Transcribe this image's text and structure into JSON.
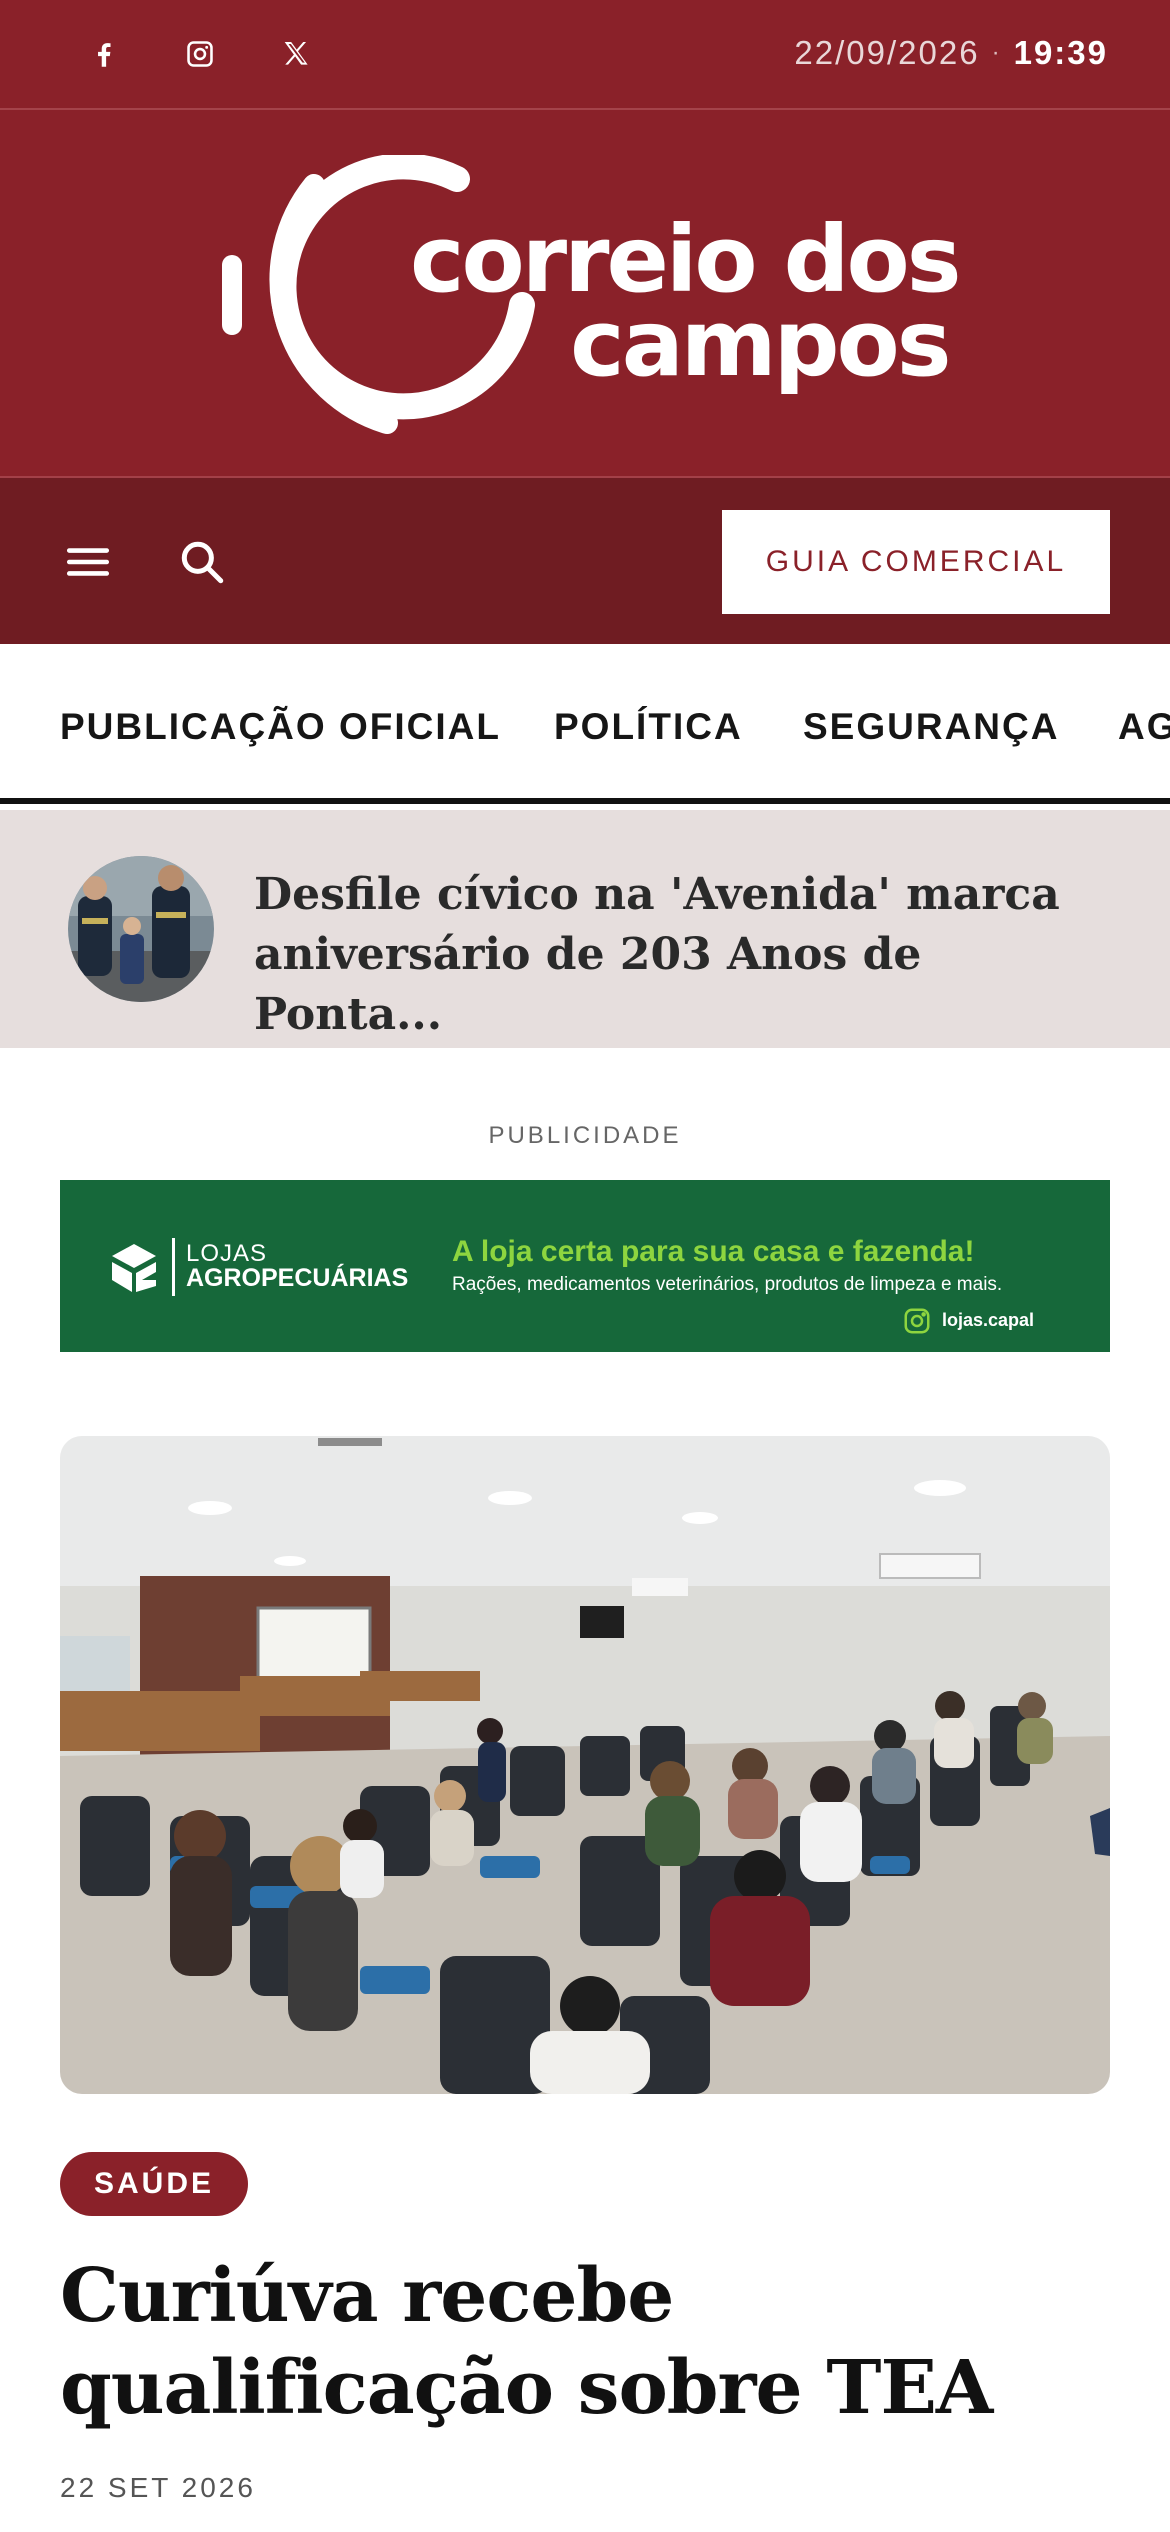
{
  "topbar": {
    "social": [
      {
        "name": "facebook-icon"
      },
      {
        "name": "instagram-icon"
      },
      {
        "name": "x-icon"
      }
    ],
    "date": "22/09/2026",
    "separator": "·",
    "time": "19:39",
    "background": "#8a2129"
  },
  "brand": {
    "line1": "correio dos",
    "line2": "campos",
    "color": "#ffffff"
  },
  "nav": {
    "menu_icon": "hamburger-menu-icon",
    "search_icon": "search-icon",
    "guia_label": "GUIA COMERCIAL",
    "background": "#6f1c22"
  },
  "categories": [
    {
      "label": "PUBLICAÇÃO OFICIAL"
    },
    {
      "label": "POLÍTICA"
    },
    {
      "label": "SEGURANÇA"
    },
    {
      "label": "AG"
    }
  ],
  "highlight": {
    "title": "Desfile cívico na 'Avenida' marca aniversário de 203 Anos de Ponta...",
    "background": "#e6dedd"
  },
  "ad": {
    "label": "PUBLICIDADE",
    "brand_line1": "LOJAS",
    "brand_line2": "AGROPECUÁRIAS",
    "headline": "A loja certa para sua casa e fazenda!",
    "subline": "Rações, medicamentos veterinários, produtos de limpeza e mais.",
    "handle": "lojas.capal",
    "background": "#16683a",
    "headline_color": "#8ed53f"
  },
  "article": {
    "category": "SAÚDE",
    "title": "Curiúva recebe qualificação sobre TEA",
    "date": "22 SET 2026",
    "accent": "#8a2129"
  }
}
